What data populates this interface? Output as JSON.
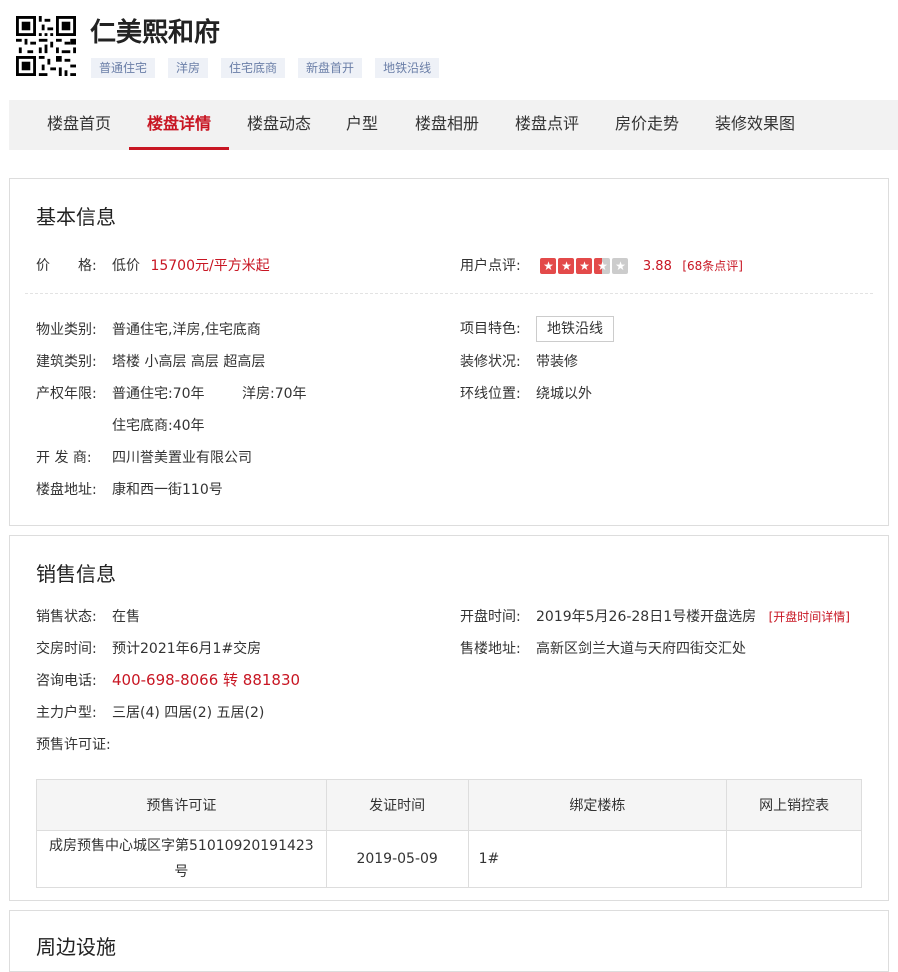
{
  "header": {
    "title": "仁美熙和府",
    "tags": [
      "普通住宅",
      "洋房",
      "住宅底商",
      "新盘首开",
      "地铁沿线"
    ]
  },
  "nav": {
    "items": [
      "楼盘首页",
      "楼盘详情",
      "楼盘动态",
      "户型",
      "楼盘相册",
      "楼盘点评",
      "房价走势",
      "装修效果图"
    ],
    "active_index": 1
  },
  "basic": {
    "heading": "基本信息",
    "price_label": "价　　格:",
    "price_prefix": "低价",
    "price_value": "15700元/平方米起",
    "rating_label": "用户点评:",
    "rating_stars": 3.5,
    "rating_score": "3.88",
    "rating_count": "[68条点评]",
    "property_type_label": "物业类别:",
    "property_type": "普通住宅,洋房,住宅底商",
    "building_type_label": "建筑类别:",
    "building_type": "塔楼 小高层 高层 超高层",
    "tenure_label": "产权年限:",
    "tenure_1": "普通住宅:70年",
    "tenure_2": "洋房:70年",
    "tenure_3": "住宅底商:40年",
    "developer_label": "开 发 商:",
    "developer": "四川誉美置业有限公司",
    "address_label": "楼盘地址:",
    "address": "康和西一街110号",
    "feature_label": "项目特色:",
    "feature": "地铁沿线",
    "decoration_label": "装修状况:",
    "decoration": "带装修",
    "ring_label": "环线位置:",
    "ring": "绕城以外"
  },
  "sales": {
    "heading": "销售信息",
    "status_label": "销售状态:",
    "status": "在售",
    "delivery_label": "交房时间:",
    "delivery": "预计2021年6月1#交房",
    "phone_label": "咨询电话:",
    "phone": "400-698-8066 转 881830",
    "layouts_label": "主力户型:",
    "layouts": "三居(4) 四居(2) 五居(2)",
    "permit_label": "预售许可证:",
    "open_label": "开盘时间:",
    "open_time": "2019年5月26-28日1号楼开盘选房",
    "open_link": "[开盘时间详情]",
    "sales_addr_label": "售楼地址:",
    "sales_addr": "高新区剑兰大道与天府四街交汇处",
    "table_headers": [
      "预售许可证",
      "发证时间",
      "绑定楼栋",
      "网上销控表"
    ],
    "table_rows": [
      {
        "permit": "成房预售中心城区字第51010920191423号",
        "date": "2019-05-09",
        "building": "1#",
        "control": ""
      }
    ]
  },
  "next_section": {
    "heading": "周边设施"
  }
}
